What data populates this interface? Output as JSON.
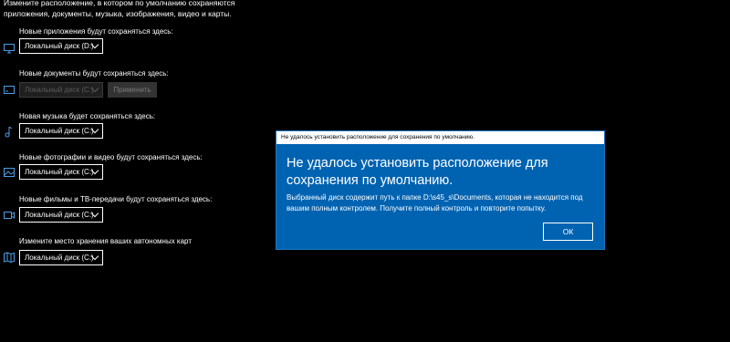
{
  "intro": {
    "line1": "Измените расположение, в котором по умолчанию сохраняются",
    "line2": "приложения, документы, музыка, изображения, видео и карты."
  },
  "sections": [
    {
      "label": "Новые приложения будут сохраняться здесь:",
      "icon": "monitor-icon",
      "drive": "Локальный диск (D:)",
      "disabled": false
    },
    {
      "label": "Новые документы будут сохраняться здесь:",
      "icon": "drive-icon",
      "drive": "Локальный диск (C:)",
      "disabled": true,
      "apply_label": "Применить"
    },
    {
      "label": "Новая музыка будет сохраняться здесь:",
      "icon": "music-note-icon",
      "drive": "Локальный диск (C:)",
      "disabled": false
    },
    {
      "label": "Новые фотографии и видео будут сохраняться здесь:",
      "icon": "picture-icon",
      "drive": "Локальный диск (C:)",
      "disabled": false
    },
    {
      "label": "Новые фильмы и ТВ-передачи будут сохраняться здесь:",
      "icon": "video-icon",
      "drive": "Локальный диск (C:)",
      "disabled": false
    },
    {
      "label": "Измените место хранения ваших автономных карт",
      "icon": "map-icon",
      "drive": "Локальный диск (C:)",
      "disabled": false
    }
  ],
  "dialog": {
    "title": "Не удалось установить расположение для сохранения по умолчанию.",
    "heading_line1": "Не удалось установить расположение для",
    "heading_line2": "сохранения по умолчанию.",
    "body_line1": "Выбранный диск содержит путь к папке D:\\s45_s\\Documents, которая не находится под",
    "body_line2": "вашим полным контролем. Получите полный контроль и повторите попытку.",
    "ok_label": "ОК"
  },
  "colors": {
    "background": "#000000",
    "dialog_blue": "#0063b1",
    "icon_blue": "#4a9fe8"
  }
}
